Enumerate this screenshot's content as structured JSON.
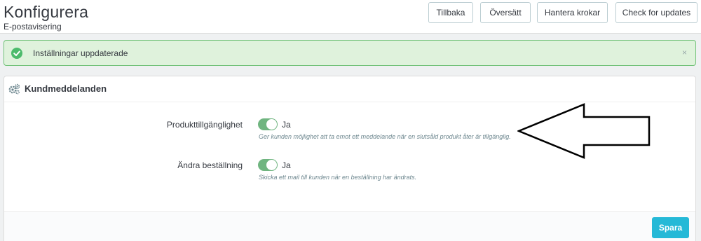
{
  "header": {
    "title": "Konfigurera",
    "subtitle": "E-postavisering",
    "buttons": [
      "Tillbaka",
      "Översätt",
      "Hantera krokar",
      "Check for updates"
    ]
  },
  "alert": {
    "message": "Inställningar uppdaterade",
    "close": "×",
    "icon": "check-circle-icon",
    "color": "#72c279"
  },
  "panel": {
    "title": "Kundmeddelanden",
    "icon": "gears-icon",
    "rows": [
      {
        "label": "Produkttillgänglighet",
        "toggle_label": "Ja",
        "enabled": true,
        "help": "Ger kunden möjlighet att ta emot ett meddelande när en slutsåld produkt åter är tillgänglig."
      },
      {
        "label": "Ändra beställning",
        "toggle_label": "Ja",
        "enabled": true,
        "help": "Skicka ett mail till kunden när en beställning har ändrats."
      }
    ],
    "save_label": "Spara"
  },
  "colors": {
    "accent": "#25b9d7",
    "toggle_on": "#70b580"
  }
}
